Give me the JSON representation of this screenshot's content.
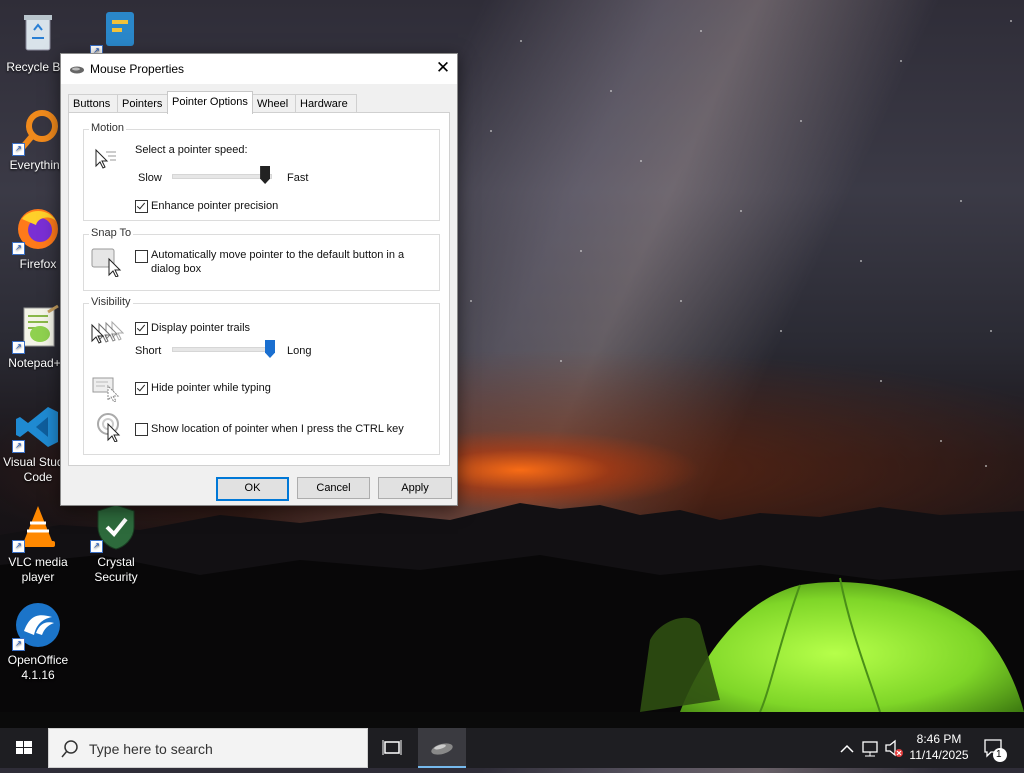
{
  "desktop": {
    "icons": [
      {
        "label": "Recycle Bin",
        "icon": "recycle-bin-icon"
      },
      {
        "label": "Everything",
        "icon": "everything-search-icon"
      },
      {
        "label": "Firefox",
        "icon": "firefox-icon"
      },
      {
        "label": "Notepad++",
        "icon": "notepad-plus-plus-icon"
      },
      {
        "label": "Visual Studio Code",
        "icon": "vscode-icon"
      },
      {
        "label": "VLC media player",
        "icon": "vlc-icon"
      },
      {
        "label": "OpenOffice 4.1.16",
        "icon": "openoffice-icon"
      },
      {
        "label": "Crystal Security",
        "icon": "crystal-security-icon"
      }
    ]
  },
  "dialog": {
    "title": "Mouse Properties",
    "close_glyph": "✕",
    "tabs": [
      {
        "label": "Buttons",
        "active": false
      },
      {
        "label": "Pointers",
        "active": false
      },
      {
        "label": "Pointer Options",
        "active": true
      },
      {
        "label": "Wheel",
        "active": false
      },
      {
        "label": "Hardware",
        "active": false
      }
    ],
    "motion": {
      "group_label": "Motion",
      "speed_label": "Select a pointer speed:",
      "slow_label": "Slow",
      "fast_label": "Fast",
      "speed_value_fraction": 0.95,
      "precision_label": "Enhance pointer precision",
      "precision_checked": true
    },
    "snap_to": {
      "group_label": "Snap To",
      "label_line1": "Automatically move pointer to the default button in a",
      "label_line2": "dialog box",
      "checked": false
    },
    "visibility": {
      "group_label": "Visibility",
      "trails_label": "Display pointer trails",
      "trails_checked": true,
      "short_label": "Short",
      "long_label": "Long",
      "trail_length_fraction": 1.0,
      "hide_label": "Hide pointer while typing",
      "hide_checked": true,
      "show_location_label": "Show location of pointer when I press the CTRL key",
      "show_location_checked": false
    },
    "buttons": {
      "ok": "OK",
      "cancel": "Cancel",
      "apply": "Apply"
    }
  },
  "taskbar": {
    "search_placeholder": "Type here to search",
    "time": "8:46 PM",
    "date": "11/14/2025",
    "notification_count": "1"
  },
  "colors": {
    "accent": "#0078d7",
    "slider_thumb": "#1a6fd0"
  }
}
